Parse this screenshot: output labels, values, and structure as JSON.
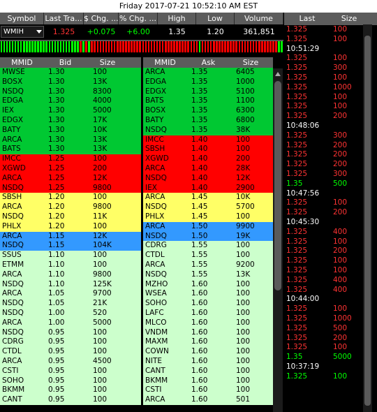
{
  "title": "Friday 2017-07-21 10:52:10 AM EST",
  "summary": {
    "headers": [
      "Symbol",
      "Last Tra...",
      "$ Chg. ...",
      "% Chg. ...",
      "High",
      "Low",
      "Volume"
    ],
    "symbol": "WMIH",
    "last": "1.325",
    "chg": "+0.075",
    "pct": "+6.00",
    "high": "1.35",
    "low": "1.20",
    "volume": "361,851"
  },
  "colors": {
    "green": "#00c832",
    "red": "#ff0000",
    "yellow": "#ffff66",
    "blue": "#3399ff",
    "light": "#ccffcc",
    "trade_up": "#00ff00",
    "trade_down": "#ff3333"
  },
  "bid_book": {
    "headers": [
      "MMID",
      "Bid",
      "Size"
    ],
    "rows": [
      [
        "MWSE",
        "1.30",
        "100",
        "green"
      ],
      [
        "BOSX",
        "1.30",
        "13K",
        "green"
      ],
      [
        "NSDQ",
        "1.30",
        "8300",
        "green"
      ],
      [
        "EDGA",
        "1.30",
        "4000",
        "green"
      ],
      [
        "IEX",
        "1.30",
        "5000",
        "green"
      ],
      [
        "EDGX",
        "1.30",
        "17K",
        "green"
      ],
      [
        "BATY",
        "1.30",
        "10K",
        "green"
      ],
      [
        "ARCA",
        "1.30",
        "13K",
        "green"
      ],
      [
        "BATS",
        "1.30",
        "13K",
        "green"
      ],
      [
        "IMCC",
        "1.25",
        "100",
        "red"
      ],
      [
        "XGWD",
        "1.25",
        "200",
        "red"
      ],
      [
        "ARCA",
        "1.25",
        "12K",
        "red"
      ],
      [
        "NSDQ",
        "1.25",
        "9800",
        "red"
      ],
      [
        "SBSH",
        "1.20",
        "100",
        "yellow"
      ],
      [
        "ARCA",
        "1.20",
        "9800",
        "yellow"
      ],
      [
        "NSDQ",
        "1.20",
        "11K",
        "yellow"
      ],
      [
        "PHLX",
        "1.20",
        "100",
        "yellow"
      ],
      [
        "ARCA",
        "1.15",
        "12K",
        "blue"
      ],
      [
        "NSDQ",
        "1.15",
        "104K",
        "blue"
      ],
      [
        "SSUS",
        "1.10",
        "100",
        "light"
      ],
      [
        "ETMM",
        "1.10",
        "100",
        "light"
      ],
      [
        "ARCA",
        "1.10",
        "9800",
        "light"
      ],
      [
        "NSDQ",
        "1.10",
        "125K",
        "light"
      ],
      [
        "ARCA",
        "1.05",
        "9700",
        "light"
      ],
      [
        "NSDQ",
        "1.05",
        "21K",
        "light"
      ],
      [
        "NSDQ",
        "1.00",
        "520",
        "light"
      ],
      [
        "ARCA",
        "1.00",
        "5000",
        "light"
      ],
      [
        "NSDQ",
        "0.95",
        "100",
        "light"
      ],
      [
        "CDRG",
        "0.95",
        "100",
        "light"
      ],
      [
        "CTDL",
        "0.95",
        "100",
        "light"
      ],
      [
        "ARCA",
        "0.95",
        "4500",
        "light"
      ],
      [
        "CSTI",
        "0.95",
        "100",
        "light"
      ],
      [
        "SOHO",
        "0.95",
        "100",
        "light"
      ],
      [
        "BKMM",
        "0.95",
        "100",
        "light"
      ],
      [
        "CANT",
        "0.95",
        "100",
        "light"
      ]
    ]
  },
  "ask_book": {
    "headers": [
      "MMID",
      "Ask",
      "Size"
    ],
    "rows": [
      [
        "ARCA",
        "1.35",
        "6405",
        "green"
      ],
      [
        "EDGA",
        "1.35",
        "1000",
        "green"
      ],
      [
        "EDGX",
        "1.35",
        "5100",
        "green"
      ],
      [
        "BATS",
        "1.35",
        "1100",
        "green"
      ],
      [
        "BOSX",
        "1.35",
        "6300",
        "green"
      ],
      [
        "BATY",
        "1.35",
        "6800",
        "green"
      ],
      [
        "NSDQ",
        "1.35",
        "38K",
        "green"
      ],
      [
        "IMCC",
        "1.40",
        "100",
        "red"
      ],
      [
        "SBSH",
        "1.40",
        "100",
        "red"
      ],
      [
        "XGWD",
        "1.40",
        "200",
        "red"
      ],
      [
        "ARCA",
        "1.40",
        "28K",
        "red"
      ],
      [
        "NSDQ",
        "1.40",
        "12K",
        "red"
      ],
      [
        "IEX",
        "1.40",
        "2900",
        "red"
      ],
      [
        "ARCA",
        "1.45",
        "10K",
        "yellow"
      ],
      [
        "NSDQ",
        "1.45",
        "5700",
        "yellow"
      ],
      [
        "PHLX",
        "1.45",
        "100",
        "yellow"
      ],
      [
        "ARCA",
        "1.50",
        "9900",
        "blue"
      ],
      [
        "NSDQ",
        "1.50",
        "19K",
        "blue"
      ],
      [
        "CDRG",
        "1.55",
        "100",
        "light"
      ],
      [
        "CTDL",
        "1.55",
        "100",
        "light"
      ],
      [
        "ARCA",
        "1.55",
        "9200",
        "light"
      ],
      [
        "NSDQ",
        "1.55",
        "13K",
        "light"
      ],
      [
        "MZHO",
        "1.60",
        "100",
        "light"
      ],
      [
        "WSEA",
        "1.60",
        "100",
        "light"
      ],
      [
        "SOHO",
        "1.60",
        "100",
        "light"
      ],
      [
        "LAFC",
        "1.60",
        "100",
        "light"
      ],
      [
        "MLCO",
        "1.60",
        "100",
        "light"
      ],
      [
        "VNDM",
        "1.60",
        "100",
        "light"
      ],
      [
        "MAXM",
        "1.60",
        "100",
        "light"
      ],
      [
        "COWN",
        "1.60",
        "100",
        "light"
      ],
      [
        "NITE",
        "1.60",
        "100",
        "light"
      ],
      [
        "CANT",
        "1.60",
        "100",
        "light"
      ],
      [
        "BKMM",
        "1.60",
        "100",
        "light"
      ],
      [
        "CSTI",
        "1.60",
        "100",
        "light"
      ],
      [
        "ARCA",
        "1.60",
        "501",
        "light"
      ]
    ]
  },
  "time_sales": {
    "headers": [
      "Last",
      "Size"
    ],
    "rows": [
      [
        "1.325",
        "100",
        "down"
      ],
      [
        "1.325",
        "100",
        "down"
      ],
      [
        "10:51:29",
        "",
        "time"
      ],
      [
        "1.325",
        "100",
        "down"
      ],
      [
        "1.325",
        "300",
        "down"
      ],
      [
        "1.325",
        "100",
        "down"
      ],
      [
        "1.325",
        "1000",
        "down"
      ],
      [
        "1.325",
        "100",
        "down"
      ],
      [
        "1.325",
        "100",
        "down"
      ],
      [
        "1.325",
        "200",
        "down"
      ],
      [
        "10:48:06",
        "",
        "time"
      ],
      [
        "1.325",
        "300",
        "down"
      ],
      [
        "1.325",
        "200",
        "down"
      ],
      [
        "1.325",
        "200",
        "down"
      ],
      [
        "1.325",
        "200",
        "down"
      ],
      [
        "1.325",
        "300",
        "down"
      ],
      [
        "1.35",
        "500",
        "up"
      ],
      [
        "10:47:56",
        "",
        "time"
      ],
      [
        "1.325",
        "100",
        "down"
      ],
      [
        "1.325",
        "200",
        "down"
      ],
      [
        "10:45:30",
        "",
        "time"
      ],
      [
        "1.325",
        "400",
        "down"
      ],
      [
        "1.325",
        "100",
        "down"
      ],
      [
        "1.325",
        "200",
        "down"
      ],
      [
        "1.325",
        "100",
        "down"
      ],
      [
        "1.325",
        "100",
        "down"
      ],
      [
        "1.325",
        "400",
        "down"
      ],
      [
        "1.325",
        "400",
        "down"
      ],
      [
        "10:44:00",
        "",
        "time"
      ],
      [
        "1.325",
        "100",
        "down"
      ],
      [
        "1.325",
        "1000",
        "down"
      ],
      [
        "1.325",
        "500",
        "down"
      ],
      [
        "1.325",
        "200",
        "down"
      ],
      [
        "1.325",
        "100",
        "down"
      ],
      [
        "1.35",
        "5000",
        "up"
      ],
      [
        "10:37:19",
        "",
        "time"
      ],
      [
        "1.325",
        "100",
        "up"
      ]
    ]
  },
  "tick_strip": [
    "g",
    "g",
    "g",
    "g",
    "g",
    "g",
    "g",
    "g",
    "g",
    "g",
    "g",
    "g",
    "g",
    "g",
    "g",
    "g",
    "g",
    "g",
    "g",
    "g",
    "g",
    "g",
    "g",
    "g",
    "g",
    "g",
    "g",
    "g",
    "r",
    "g",
    "r",
    "g",
    "r",
    "r",
    "r",
    "r",
    "r",
    "r",
    "r",
    "r",
    "r",
    "r",
    "r",
    "r",
    "r",
    "r",
    "r",
    "r",
    "r",
    "r",
    "r",
    "r",
    "r",
    "r",
    "r",
    "r",
    "r",
    "r",
    "r",
    "r",
    "r",
    "r",
    "r",
    "r",
    "r",
    "r",
    "r",
    "r",
    "r",
    "r",
    "g",
    "r",
    "r",
    "r",
    "r",
    "r",
    "r",
    "r",
    "r",
    "r",
    "r",
    "r",
    "r",
    "r",
    "r",
    "r",
    "r",
    "r",
    "r",
    "r",
    "r",
    "r",
    "r",
    "r",
    "r",
    "r",
    "r",
    "r",
    "g",
    "g"
  ]
}
